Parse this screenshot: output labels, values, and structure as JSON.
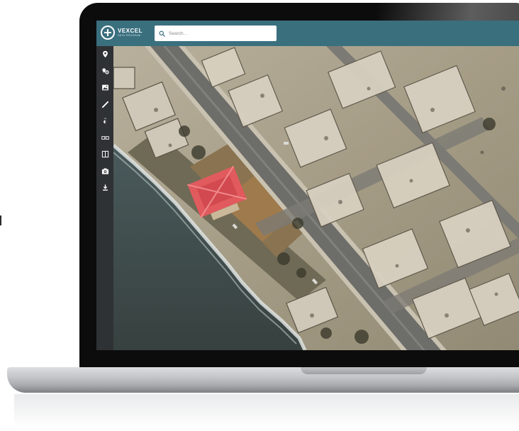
{
  "app": {
    "brand": "VEXCEL",
    "brand_sub": "DATA PROGRAM"
  },
  "search": {
    "placeholder": "Search..."
  },
  "sidebar": {
    "tools": [
      {
        "icon": "location-pin-icon"
      },
      {
        "icon": "location-settings-icon"
      },
      {
        "icon": "image-layer-icon"
      },
      {
        "icon": "measure-ruler-icon"
      },
      {
        "icon": "brightness-icon"
      },
      {
        "icon": "compare-icon"
      },
      {
        "icon": "split-view-icon"
      },
      {
        "icon": "camera-icon"
      },
      {
        "icon": "download-icon"
      }
    ]
  },
  "colors": {
    "topbar": "#3a6f7e",
    "sidebar": "#2f3234",
    "roof_highlight": "#e05a5e",
    "ocean": "#3d4b4d",
    "road": "#6d6d6a"
  }
}
